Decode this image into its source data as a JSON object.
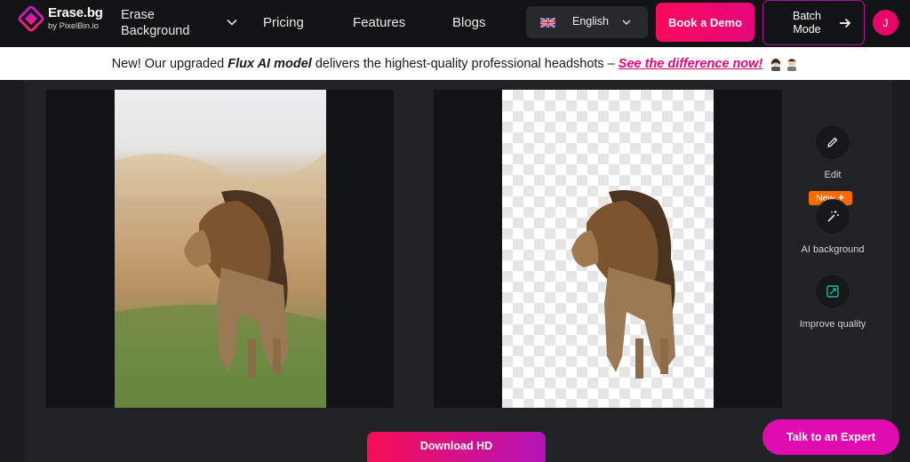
{
  "header": {
    "logo_title": "Erase.bg",
    "logo_sub": "by PixelBin.io",
    "product_line1": "Erase",
    "product_line2": "Background",
    "nav": [
      "Pricing",
      "Features",
      "Blogs"
    ],
    "language": "English",
    "demo_label": "Book a Demo",
    "batch_line1": "Batch",
    "batch_line2": "Mode",
    "avatar_initial": "J"
  },
  "banner": {
    "prefix": "New! Our upgraded",
    "model": "Flux AI model",
    "middle": "delivers the highest-quality professional headshots –",
    "cta": "See the difference now!"
  },
  "tools": [
    {
      "label": "Edit",
      "icon": "pencil-icon"
    },
    {
      "label": "AI background",
      "icon": "magic-wand-icon",
      "badge": "New"
    },
    {
      "label": "Improve quality",
      "icon": "enhance-icon"
    }
  ],
  "download_label": "Download HD",
  "expert_label": "Talk to an Expert",
  "colors": {
    "brand_pink": "#e5087c",
    "badge_orange": "#ff6a00",
    "expert": "#e10cb1"
  }
}
